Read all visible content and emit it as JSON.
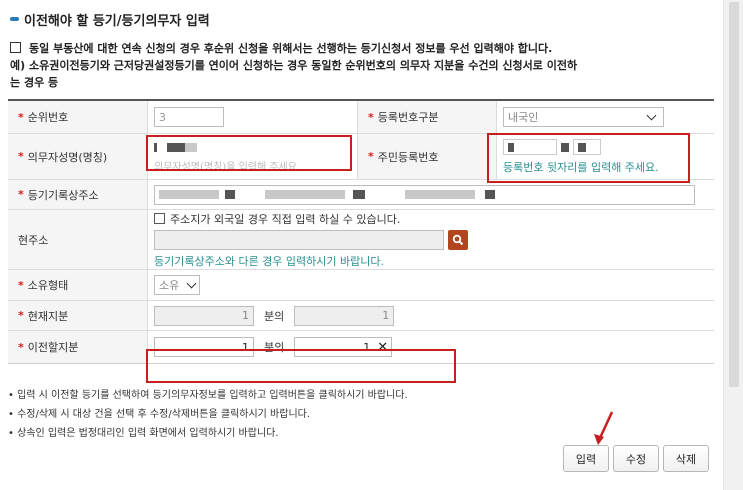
{
  "section": {
    "title": "이전해야 할 등기/등기의무자 입력",
    "notice_line1": "동일 부동산에 대한 연속 신청의 경우 후순위 신청을 위해서는 선행하는 등기신청서 정보를 우선 입력해야 합니다.",
    "notice_line2": "예) 소유권이전등기와 근저당권설정등기를 연이어 신청하는 경우 동일한 순위번호의 의무자 지분을 수건의 신청서로 이전하",
    "notice_line3": "는 경우 등"
  },
  "form": {
    "rank_no": {
      "label": "순위번호",
      "value": "3"
    },
    "reg_type": {
      "label": "등록번호구분",
      "selected": "내국인"
    },
    "obligor_name": {
      "label": "의무자성명(명칭)",
      "placeholder": "의무자성명(명칭)을 입력해 주세요."
    },
    "resident_no": {
      "label": "주민등록번호",
      "hint": "등록번호 뒷자리를 입력해 주세요."
    },
    "reg_address": {
      "label": "등기기록상주소"
    },
    "current_address": {
      "label": "현주소",
      "foreign_checkbox_label": "주소지가 외국일 경우 직접 입력 하실 수 있습니다.",
      "hint": "등기기록상주소와 다른 경우 입력하시기 바랍니다."
    },
    "ownership_type": {
      "label": "소유형태",
      "selected": "소유"
    },
    "current_share": {
      "label": "현재지분",
      "numerator": "1",
      "between": "분의",
      "denominator": "1"
    },
    "transfer_share": {
      "label": "이전할지분",
      "numerator": "1",
      "between": "분의",
      "denominator": "1"
    }
  },
  "notes": [
    "• 입력 시 이전할 등기를 선택하여 등기의무자정보를 입력하고 입력버튼을 클릭하시기 바랍니다.",
    "• 수정/삭제 시 대상 건을 선택 후 수정/삭제버튼을 클릭하시기 바랍니다.",
    "• 상속인 입력은 법정대리인 입력 화면에서 입력하시기 바랍니다."
  ],
  "buttons": {
    "input": "입력",
    "edit": "수정",
    "delete": "삭제"
  },
  "colors": {
    "accent": "#2a7ab8",
    "highlight": "#c81e1e",
    "search_button": "#b1451d",
    "hint_text": "#2a8f8f"
  }
}
